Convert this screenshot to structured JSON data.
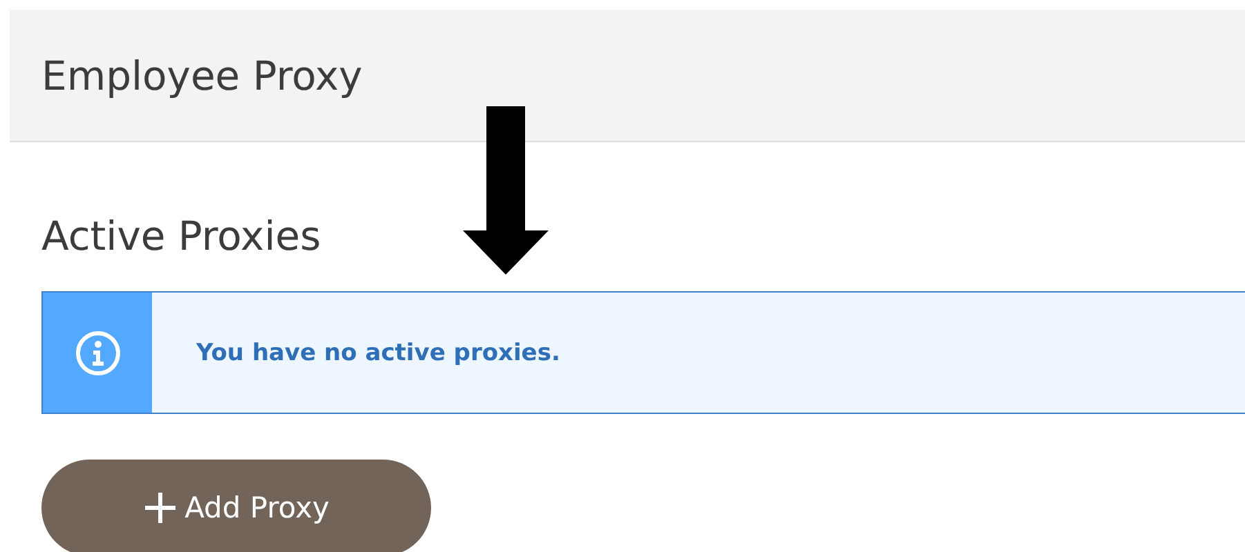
{
  "header": {
    "title": "Employee Proxy"
  },
  "section": {
    "title": "Active Proxies"
  },
  "alert": {
    "kind": "info",
    "message": "You have no active proxies."
  },
  "add_button": {
    "label": "Add Proxy"
  }
}
